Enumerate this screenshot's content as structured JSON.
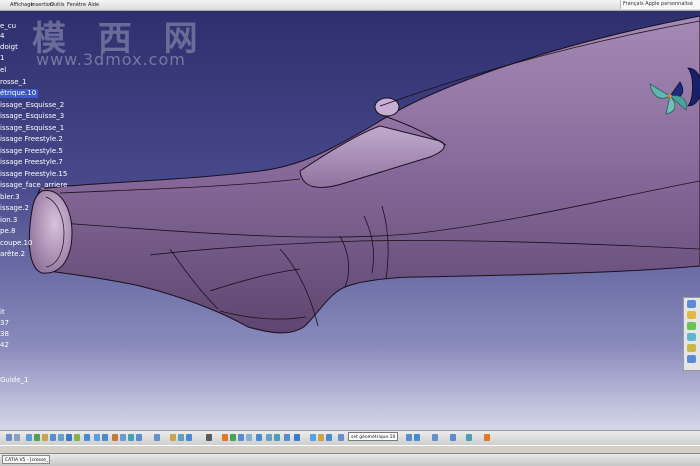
{
  "menu": {
    "items": [
      "Affichage",
      "Insertion",
      "Outils",
      "Fenêtre",
      "Aide"
    ],
    "language_bar": "Français Apple personnalisé"
  },
  "watermark": {
    "chinese": "模 西 网",
    "url": "www.3dmox.com"
  },
  "tree": {
    "items": [
      {
        "label": "e_cu"
      },
      {
        "label": "4"
      },
      {
        "label": "doigt"
      },
      {
        "label": "1"
      },
      {
        "label": "el"
      },
      {
        "label": "rosse_1"
      },
      {
        "label": "étrique.10",
        "selected": true
      },
      {
        "label": "issage_Esquisse_2"
      },
      {
        "label": "issage_Esquisse_3"
      },
      {
        "label": "issage_Esquisse_1"
      },
      {
        "label": "issage Freestyle.2"
      },
      {
        "label": "issage Freestyle.5"
      },
      {
        "label": "issage Freestyle.7"
      },
      {
        "label": "issage Freestyle.15"
      },
      {
        "label": "issage_face_arriere"
      },
      {
        "label": "bler.3"
      },
      {
        "label": "issage.2"
      },
      {
        "label": "ion.3"
      },
      {
        "label": "pe.8"
      },
      {
        "label": "coupe.10"
      },
      {
        "label": "arête.2"
      },
      {
        "label": "it"
      },
      {
        "label": "37"
      },
      {
        "label": "38"
      },
      {
        "label": "42"
      },
      {
        "label": "Guide_1"
      }
    ]
  },
  "toolbar": {
    "combo_value": "set géométrique.10"
  },
  "taskbar": {
    "task_label": "CATIA V5 - [crosse_1..."
  },
  "colors": {
    "background_top": "#2e2f6e",
    "background_bottom": "#d6d7ea",
    "model_fill": "#8a6c9c",
    "selection": "#3b59c8"
  }
}
